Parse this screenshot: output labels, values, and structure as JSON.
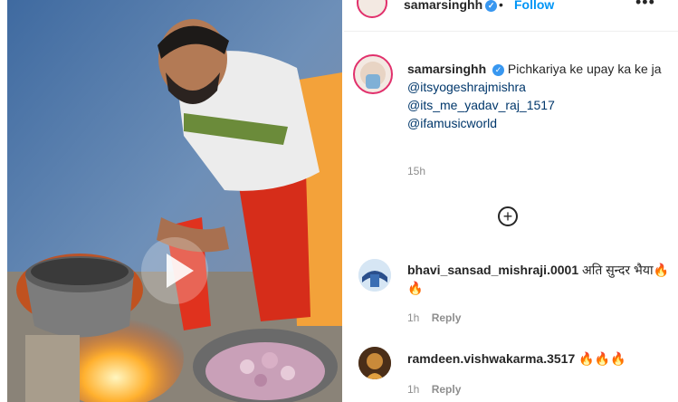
{
  "header": {
    "username": "samarsinghh",
    "dot": "•",
    "follow_label": "Follow",
    "more_label": "•••"
  },
  "caption": {
    "username": "samarsinghh",
    "text": "Pichkariya ke upay ka ke ja",
    "mentions": [
      "@itsyogeshrajmishra",
      "@its_me_yadav_raj_1517",
      "@ifamusicworld"
    ],
    "time": "15h"
  },
  "load_more_icon": "plus-circle-icon",
  "comments": [
    {
      "username": "bhavi_sansad_mishraji.0001",
      "text": "अति सुन्दर भैया🔥🔥",
      "time": "1h",
      "reply_label": "Reply"
    },
    {
      "username": "ramdeen.vishwakarma.3517",
      "text": "🔥🔥🔥",
      "time": "1h",
      "reply_label": "Reply"
    }
  ],
  "colors": {
    "link_blue": "#0095f6",
    "mention_blue": "#00376b",
    "muted": "#8e8e8e",
    "verified": "#3897f0"
  }
}
